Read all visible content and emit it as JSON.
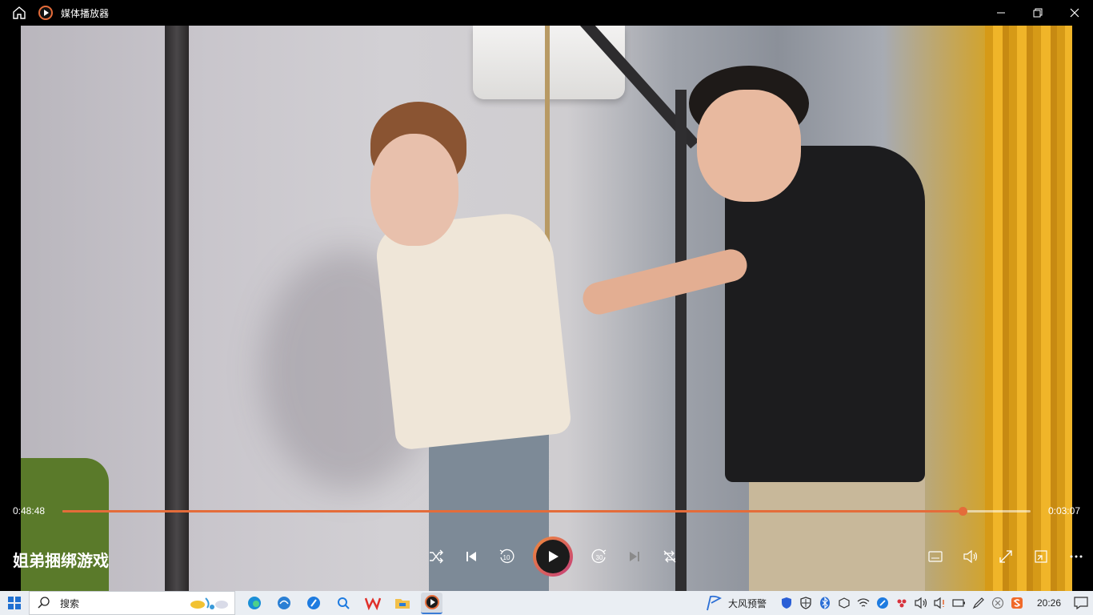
{
  "window": {
    "title": "媒体播放器"
  },
  "player": {
    "elapsed": "0:48:48",
    "remaining": "0:03:07",
    "progress_fraction": 0.93,
    "media_title": "姐弟捆绑游戏",
    "accent_color": "#e46c3a"
  },
  "controls": {
    "center": [
      "shuffle-icon",
      "previous-icon",
      "rewind-10-icon",
      "play-icon",
      "forward-30-icon",
      "next-icon",
      "repeat-off-icon"
    ],
    "right": [
      "subtitles-icon",
      "volume-icon",
      "fullscreen-icon",
      "mini-player-icon",
      "more-icon"
    ],
    "rewind_label": "10",
    "forward_label": "30"
  },
  "taskbar": {
    "search_placeholder": "搜索",
    "weather_text": "大风预警",
    "clock": "20:26"
  }
}
